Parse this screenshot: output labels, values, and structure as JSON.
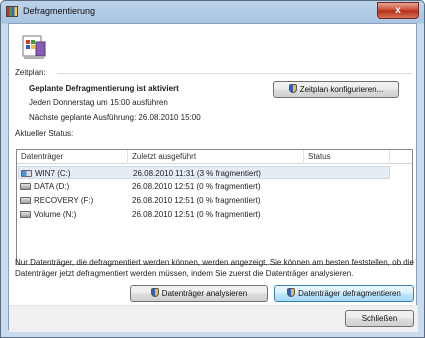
{
  "window": {
    "title": "Defragmentierung",
    "close_glyph": "x"
  },
  "icons": {
    "app": "defrag-app-icon",
    "main": "defrag-icon",
    "shield": "uac-shield-icon",
    "drive": "hard-drive-icon",
    "system_drive": "windows-drive-icon"
  },
  "schedule": {
    "label": "Zeitplan:",
    "status": "Geplante Defragmentierung ist aktiviert",
    "frequency": "Jeden Donnerstag um 15:00 ausführen",
    "next_run": "Nächste geplante Ausführung: 26.08.2010 15:00",
    "configure_button": "Zeitplan konfigurieren..."
  },
  "current_status": {
    "label": "Aktueller Status:",
    "columns": [
      "Datenträger",
      "Zuletzt ausgeführt",
      "Status"
    ],
    "rows": [
      {
        "drive": "WIN7 (C:)",
        "last_run": "26.08.2010 11:31 (3 % fragmentiert)",
        "status": ""
      },
      {
        "drive": "DATA (D:)",
        "last_run": "26.08.2010 12:51 (0 % fragmentiert)",
        "status": ""
      },
      {
        "drive": "RECOVERY (F:)",
        "last_run": "26.08.2010 12:51 (0 % fragmentiert)",
        "status": ""
      },
      {
        "drive": "Volume (N:)",
        "last_run": "26.08.2010 12:51 (0 % fragmentiert)",
        "status": ""
      }
    ]
  },
  "info": {
    "line1": "Nur Datenträger, die defragmentiert werden können, werden angezeigt. Sie können am besten feststellen, ob die",
    "line2": "Datenträger jetzt defragmentiert werden müssen, indem Sie zuerst die Datenträger analysieren."
  },
  "actions": {
    "analyze_button": "Datenträger analysieren",
    "defrag_button": "Datenträger defragmentieren",
    "close_button": "Schließen"
  },
  "colors": {
    "title_gradient": "#a9c4e2",
    "close_button": "#c9452e",
    "focus_border": "#3c7fb1"
  }
}
